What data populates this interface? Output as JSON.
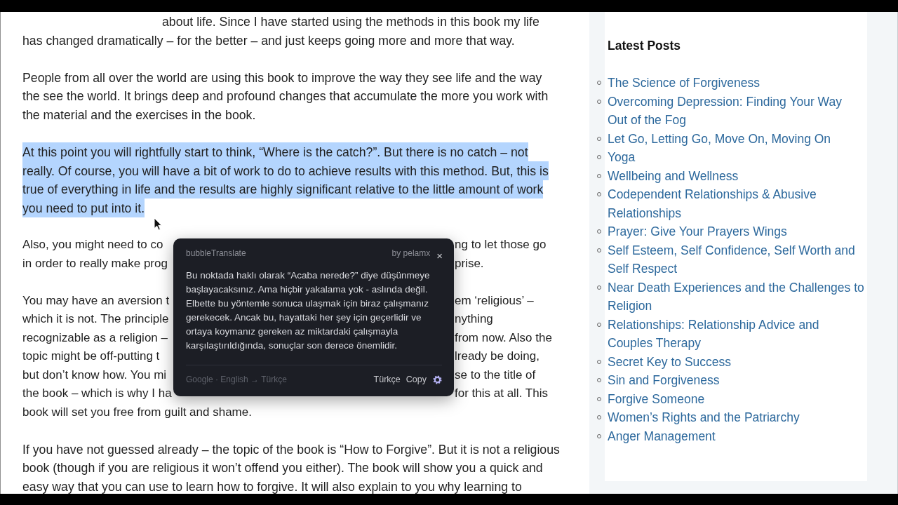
{
  "article": {
    "paragraphs": [
      {
        "kind": "continued",
        "selected": false,
        "text": "about life. Since I have started using the methods in this book my life has changed dramatically – for the better – and just keeps going more and more that way."
      },
      {
        "kind": "text",
        "selected": false,
        "text": "People from all over the world are using this book to improve the way they see life and the way the see the world. It brings deep and profound changes that accumulate the more you work with the material and the exercises in the book."
      },
      {
        "kind": "text",
        "selected": true,
        "text": "At this point you will rightfully start to think, “Where is the catch?”. But there is no catch – not really. Of course, you will have a bit of work to do to achieve results with this method. But, this is true of everything in life and the results are highly significant relative to the little amount of work you need to put into it."
      },
      {
        "kind": "covered",
        "selected": false,
        "lines": [
          {
            "left": "Also, you might need to co",
            "right": "ng to let those go"
          },
          {
            "left": "in order to really make prog",
            "right": "prise."
          }
        ]
      },
      {
        "kind": "covered",
        "selected": false,
        "lines": [
          {
            "left": "You may have an aversion t",
            "right": "em ‘religious’ –"
          },
          {
            "left": "which it is not. The principle",
            "right": "nything"
          },
          {
            "left": "recognizable as a religion –",
            "right": "from now. Also the"
          },
          {
            "left": "topic might be off-putting t",
            "right": "lready be doing,"
          },
          {
            "left": "but don’t know how. You mi",
            "right": "se to the title of"
          },
          {
            "left": "the book – which is why I ha",
            "right": "for this at all. This"
          },
          {
            "left": "book will set you free from guilt and shame."
          }
        ]
      },
      {
        "kind": "text",
        "selected": false,
        "text": "If you have not guessed already – the topic of the book is “How to Forgive”. But it is not a religious book (though if you are religious it won’t offend you either). The book will show you a quick and easy way that you can use to learn how to forgive. It will also explain to you why learning to"
      }
    ]
  },
  "sidebar": {
    "heading": "Latest Posts",
    "posts": [
      "The Science of Forgiveness",
      "Overcoming Depression: Finding Your Way Out of the Fog",
      "Let Go, Letting Go, Move On, Moving On",
      "Yoga",
      "Wellbeing and Wellness",
      "Codependent Relationships & Abusive Relationships",
      "Prayer: Give Your Prayers Wings",
      "Self Esteem, Self Confidence, Self Worth and Self Respect",
      "Near Death Experiences and the Challenges to Religion",
      "Relationships: Relationship Advice and Couples Therapy",
      "Secret Key to Success",
      "Sin and Forgiveness",
      "Forgive Someone",
      "Women’s Rights and the Patriarchy",
      "Anger Management"
    ]
  },
  "translate_popup": {
    "app_name": "bubbleTranslate",
    "author": "by pelamx",
    "close": "×",
    "translation": "Bu noktada haklı olarak “Acaba nerede?” diye düşünmeye başlayacaksınız. Ama hiçbir yakalama yok - aslında değil. Elbette bu yöntemle sonuca ulaşmak için biraz çalışmanız gerekecek. Ancak bu, hayattaki her şey için geçerlidir ve ortaya koymanız gereken az miktardaki çalışmayla karşılaştırıldığında, sonuçlar son derece önemlidir.",
    "source": "Google · English → Türkçe",
    "buttons": [
      "Türkçe",
      "Copy"
    ]
  }
}
